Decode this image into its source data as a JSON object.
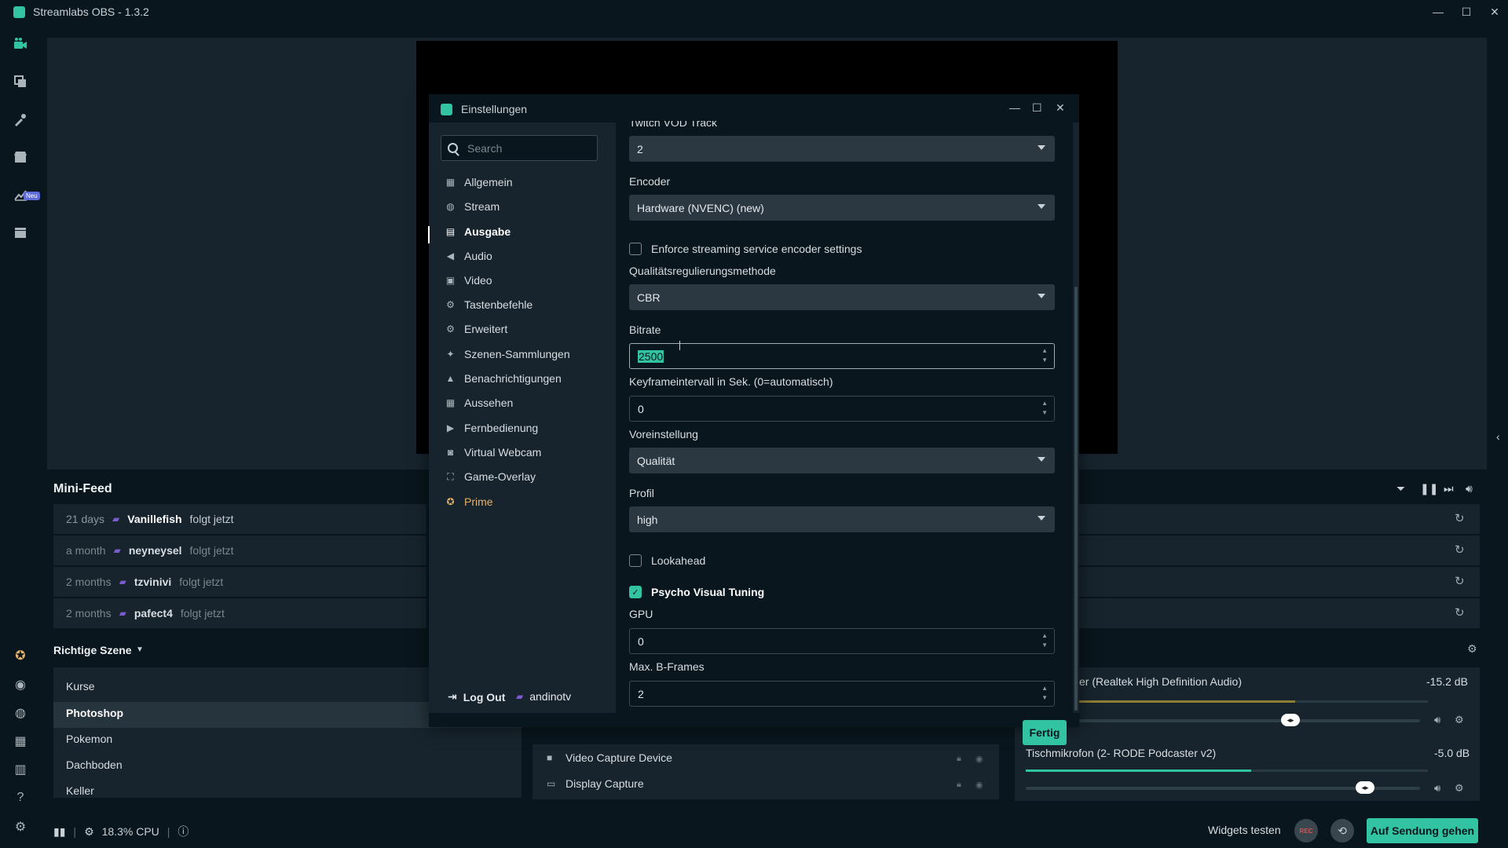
{
  "window": {
    "title": "Streamlabs OBS - 1.3.2",
    "controls": [
      "—",
      "☐",
      "✕"
    ]
  },
  "leftnav": {
    "badge": "Neu"
  },
  "minifeed": {
    "title": "Mini-Feed",
    "rows": [
      {
        "time": "21 days",
        "name": "Vanillefish",
        "action": "folgt jetzt"
      },
      {
        "time": "a month",
        "name": "neyneysel",
        "action": "folgt jetzt"
      },
      {
        "time": "2 months",
        "name": "tzvinivi",
        "action": "folgt jetzt"
      },
      {
        "time": "2 months",
        "name": "pafect4",
        "action": "folgt jetzt"
      }
    ]
  },
  "scenes": {
    "title": "Richtige Szene",
    "items": [
      "Kurse",
      "Photoshop",
      "Pokemon",
      "Dachboden",
      "Keller"
    ],
    "selected": "Photoshop"
  },
  "sources": {
    "items": [
      "Video Capture Device",
      "Display Capture"
    ]
  },
  "mixer": {
    "channels": [
      {
        "name": "er (Realtek High Definition Audio)",
        "db": "-15.2 dB",
        "level": 0.62,
        "volume": 0.62
      },
      {
        "name": "Tischmikrofon (2- RODE Podcaster v2)",
        "db": "-5.0 dB",
        "level": 0.56,
        "volume": 0.86
      }
    ]
  },
  "footer": {
    "cpu": "18.3% CPU",
    "widgets_test": "Widgets testen",
    "rec": "REC",
    "go_live": "Auf Sendung gehen"
  },
  "dialog": {
    "title": "Einstellungen",
    "search_placeholder": "Search",
    "nav": [
      {
        "label": "Allgemein",
        "icon": "grid-icon"
      },
      {
        "label": "Stream",
        "icon": "globe-icon"
      },
      {
        "label": "Ausgabe",
        "icon": "database-icon"
      },
      {
        "label": "Audio",
        "icon": "speaker-icon"
      },
      {
        "label": "Video",
        "icon": "film-icon"
      },
      {
        "label": "Tastenbefehle",
        "icon": "gear-icon"
      },
      {
        "label": "Erweitert",
        "icon": "gears-icon"
      },
      {
        "label": "Szenen-Sammlungen",
        "icon": "wand-icon"
      },
      {
        "label": "Benachrichtigungen",
        "icon": "bell-icon"
      },
      {
        "label": "Aussehen",
        "icon": "grid-icon"
      },
      {
        "label": "Fernbedienung",
        "icon": "play-circle-icon"
      },
      {
        "label": "Virtual Webcam",
        "icon": "camera-icon"
      },
      {
        "label": "Game-Overlay",
        "icon": "expand-icon"
      },
      {
        "label": "Prime",
        "icon": "prime-icon"
      }
    ],
    "active_nav": "Ausgabe",
    "logout": "Log Out",
    "user": "andinotv",
    "fields": {
      "twitch_vod_track_label": "Twitch VOD Track",
      "twitch_vod_track_value": "2",
      "encoder_label": "Encoder",
      "encoder_value": "Hardware (NVENC) (new)",
      "enforce_label": "Enforce streaming service encoder settings",
      "rate_control_label": "Qualitätsregulierungsmethode",
      "rate_control_value": "CBR",
      "bitrate_label": "Bitrate",
      "bitrate_value": "2500",
      "keyframe_label": "Keyframeintervall in Sek. (0=automatisch)",
      "keyframe_value": "0",
      "preset_label": "Voreinstellung",
      "preset_value": "Qualität",
      "profile_label": "Profil",
      "profile_value": "high",
      "lookahead_label": "Lookahead",
      "psycho_label": "Psycho Visual Tuning",
      "gpu_label": "GPU",
      "gpu_value": "0",
      "bframes_label": "Max. B-Frames",
      "bframes_value": "2"
    },
    "done": "Fertig"
  },
  "colors": {
    "accent": "#31c3a2",
    "bg": "#09161d",
    "panel": "#17242d",
    "prime": "#e4b26a",
    "twitch": "#7b5ccf"
  }
}
